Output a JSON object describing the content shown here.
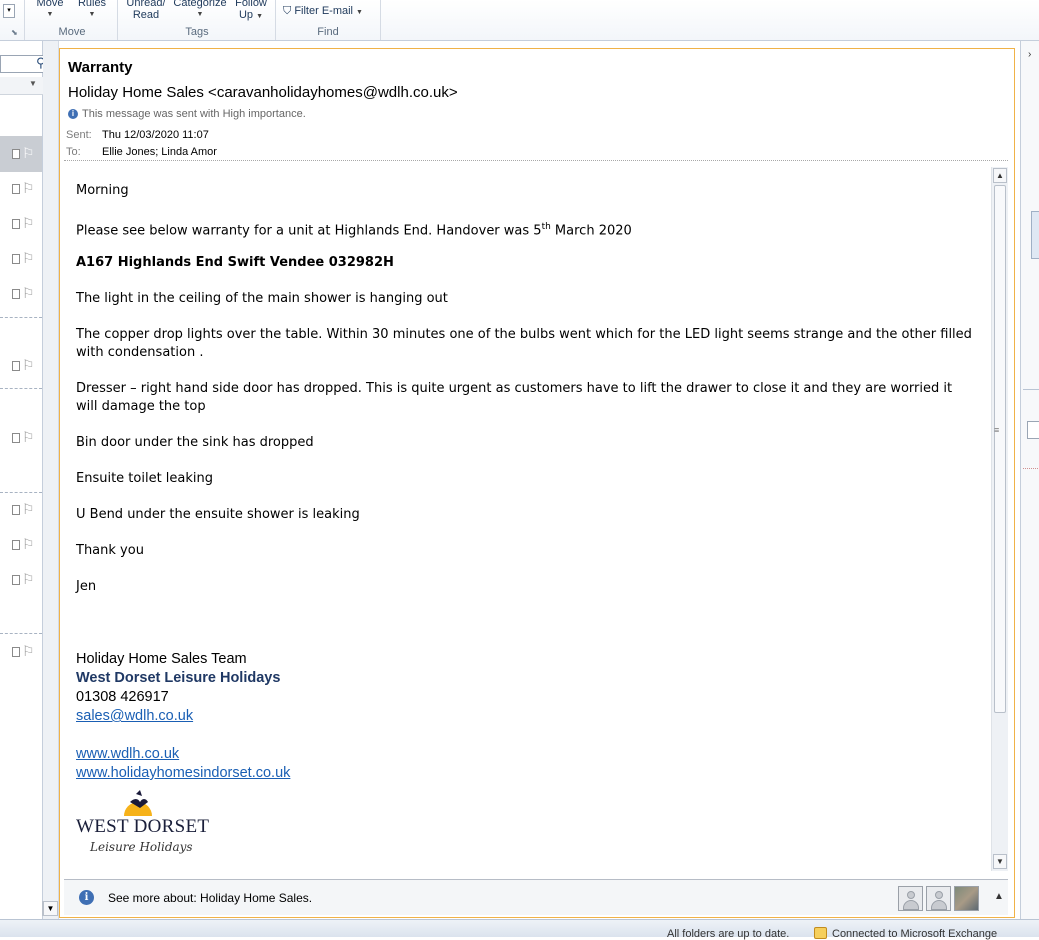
{
  "ribbon": {
    "move_label": "Move",
    "rules_label": "Rules",
    "unread_label_1": "Unread/",
    "unread_label_2": "Read",
    "categorize_label": "Categorize",
    "followup_label_1": "Follow",
    "followup_label_2": "Up",
    "filter_label": "Filter E-mail",
    "group_move": "Move",
    "group_tags": "Tags",
    "group_find": "Find"
  },
  "message": {
    "subject": "Warranty",
    "from": "Holiday Home Sales <caravanholidayhomes@wdlh.co.uk>",
    "importance_note": "This message was sent with High importance.",
    "sent_label": "Sent:",
    "sent_value": "Thu 12/03/2020 11:07",
    "to_label": "To:",
    "to_value": "Ellie Jones; Linda Amor"
  },
  "body": {
    "greeting": "Morning",
    "intro_pre": "Please see below warranty for a unit at Highlands End. Handover was 5",
    "intro_sup": "th",
    "intro_post": " March 2020",
    "unit": "A167 Highlands End Swift Vendee 032982H",
    "item1": "The light in the ceiling of the main shower is hanging out",
    "item2": "The copper drop lights over the table. Within 30 minutes one of the bulbs went which for the LED light seems strange and the other filled with condensation .",
    "item3": "Dresser – right hand side door has dropped. This is quite urgent as customers have to lift the drawer to close it and they are worried it will damage the top",
    "item4": "Bin door under the sink has dropped",
    "item5": "Ensuite toilet leaking",
    "item6": "U Bend under the ensuite shower is leaking",
    "thanks": "Thank you",
    "signoff": "Jen"
  },
  "signature": {
    "team": "Holiday Home Sales Team",
    "company": "West Dorset Leisure Holidays",
    "phone": "01308 426917",
    "email": "sales@wdlh.co.uk",
    "website1": "www.wdlh.co.uk",
    "website2": "www.holidayhomesindorset.co.uk",
    "logo_main": "WEST DORSET",
    "logo_sub": "Leisure Holidays"
  },
  "people_pane": {
    "text": "See more about: Holiday Home Sales."
  },
  "status_bar": {
    "folders": "All folders are up to date.",
    "connection": "Connected to Microsoft Exchange"
  },
  "colors": {
    "accent_border": "#f0b247",
    "link": "#1a5fb4",
    "company": "#1f3864"
  }
}
